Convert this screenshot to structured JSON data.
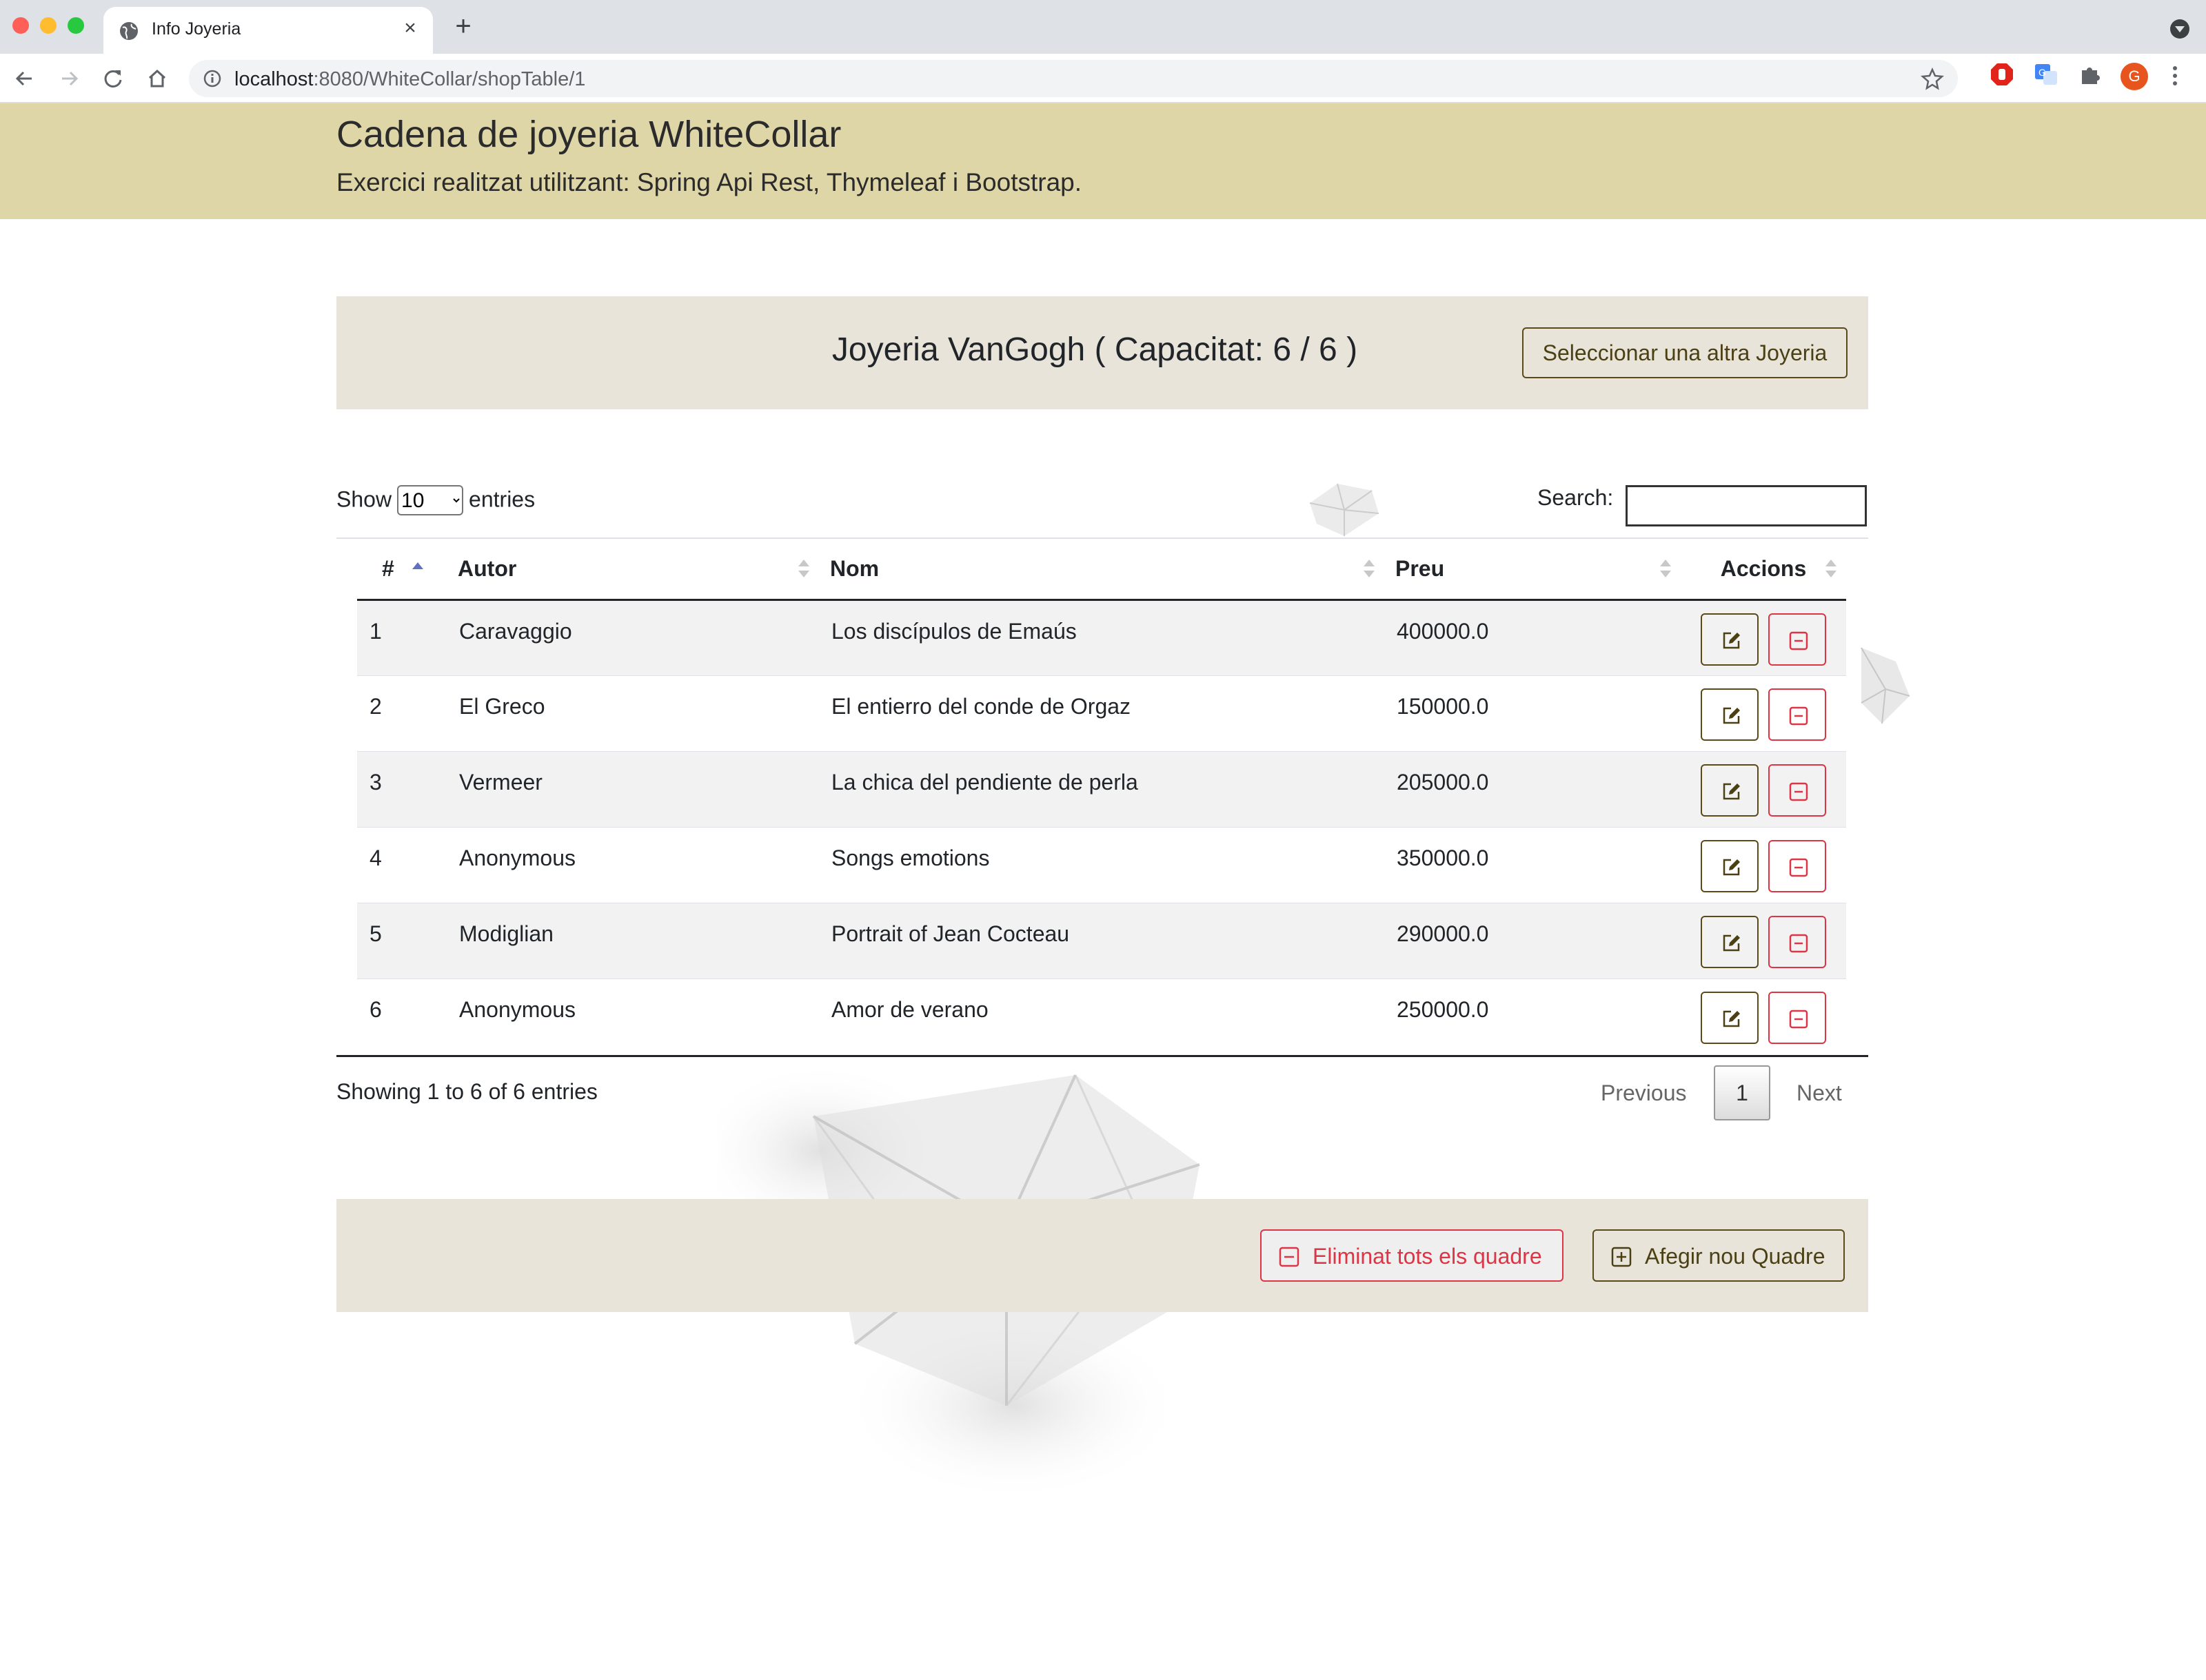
{
  "browser": {
    "tab_title": "Info Joyeria",
    "url_host": "localhost",
    "url_path": ":8080/WhiteCollar/shopTable/1",
    "profile_initial": "G"
  },
  "header": {
    "title": "Cadena de joyeria WhiteCollar",
    "subtitle": "Exercici realitzat utilitzant: Spring Api Rest, Thymeleaf i Bootstrap."
  },
  "shop": {
    "title": "Joyeria VanGogh ( Capacitat: 6 / 6 )",
    "select_button": "Seleccionar una altra Joyeria"
  },
  "datatable": {
    "show_label": "Show",
    "entries_label": "entries",
    "length_selected": "10",
    "search_label": "Search:",
    "search_value": "",
    "columns": [
      "#",
      "Autor",
      "Nom",
      "Preu",
      "Accions"
    ],
    "rows": [
      {
        "num": "1",
        "autor": "Caravaggio",
        "nom": "Los discípulos de Emaús",
        "preu": "400000.0"
      },
      {
        "num": "2",
        "autor": "El Greco",
        "nom": "El entierro del conde de Orgaz",
        "preu": "150000.0"
      },
      {
        "num": "3",
        "autor": "Vermeer",
        "nom": "La chica del pendiente de perla",
        "preu": "205000.0"
      },
      {
        "num": "4",
        "autor": "Anonymous",
        "nom": "Songs emotions",
        "preu": "350000.0"
      },
      {
        "num": "5",
        "autor": "Modiglian",
        "nom": "Portrait of Jean Cocteau",
        "preu": "290000.0"
      },
      {
        "num": "6",
        "autor": "Anonymous",
        "nom": "Amor de verano",
        "preu": "250000.0"
      }
    ],
    "info": "Showing 1 to 6 of 6 entries",
    "previous_label": "Previous",
    "current_page": "1",
    "next_label": "Next"
  },
  "footer": {
    "delete_all_button": "Eliminat tots els quadre",
    "add_button": "Afegir nou Quadre"
  },
  "colors": {
    "header_bg": "#dfd6a7",
    "card_bg": "#e8e4d9",
    "dark_outline": "#5a4a19",
    "danger": "#dc3545"
  },
  "icons": {
    "edit": "edit-icon",
    "remove": "minus-square-icon",
    "add": "plus-square-icon"
  }
}
